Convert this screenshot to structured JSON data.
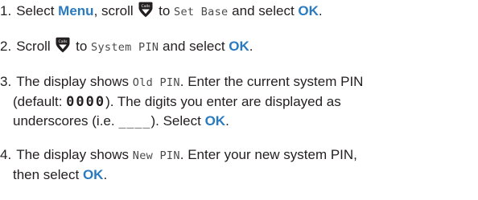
{
  "steps": [
    {
      "number": "1.",
      "t1": "Select ",
      "key1": "Menu",
      "t2": ", scroll ",
      "t3": " to ",
      "lcd1": "Set Base",
      "t4": " and select ",
      "key2": "OK",
      "t5": "."
    },
    {
      "number": "2.",
      "t1": "Scroll ",
      "t2": " to ",
      "lcd1": "System PIN",
      "t3": " and select ",
      "key1": "OK",
      "t4": "."
    },
    {
      "number": "3.",
      "t1": "The display shows ",
      "lcd1": "Old PIN",
      "t2": ". Enter the current system PIN",
      "t3": "(default: ",
      "pin": "0000",
      "t4": "). The digits you enter are displayed as",
      "t5": "underscores (i.e. ",
      "underscores": "____",
      "t6": "). Select ",
      "key1": "OK",
      "t7": "."
    },
    {
      "number": "4.",
      "t1": "The display shows ",
      "lcd1": "New PIN",
      "t2": ". Enter your new system PIN,",
      "t3": "then select ",
      "key1": "OK",
      "t4": "."
    }
  ],
  "icons": {
    "scroll": "calls-scroll-down-icon",
    "scroll_label": "Calls"
  },
  "colors": {
    "text": "#231f20",
    "key": "#2a7abf",
    "icon": "#231f20"
  }
}
